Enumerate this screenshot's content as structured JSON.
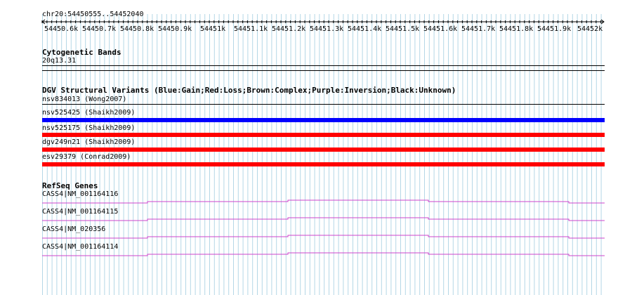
{
  "track": {
    "coordinate_label": "chr20:54450555..54452040",
    "ruler_ticks": [
      "54450.6k",
      "54450.7k",
      "54450.8k",
      "54450.9k",
      "54451k",
      "54451.1k",
      "54451.2k",
      "54451.3k",
      "54451.4k",
      "54451.5k",
      "54451.6k",
      "54451.7k",
      "54451.8k",
      "54451.9k",
      "54452k"
    ]
  },
  "cytogenetic": {
    "title": "Cytogenetic Bands",
    "band": "20q13.31"
  },
  "dgv": {
    "title": "DGV Structural Variants (Blue:Gain;Red:Loss;Brown:Complex;Purple:Inversion;Black:Unknown)",
    "variants": [
      {
        "label": "nsv834013 (Wong2007)",
        "type": "unknown",
        "color": "#000000"
      },
      {
        "label": "nsv525425 (Shaikh2009)",
        "type": "gain",
        "color": "#0000ff"
      },
      {
        "label": "nsv525175 (Shaikh2009)",
        "type": "loss",
        "color": "#ff0000"
      },
      {
        "label": "dgv249n21 (Shaikh2009)",
        "type": "loss",
        "color": "#ff0000"
      },
      {
        "label": "esv29379 (Conrad2009)",
        "type": "loss",
        "color": "#ff0000"
      }
    ]
  },
  "refseq": {
    "title": "RefSeq Genes",
    "genes": [
      {
        "label": "CASS4|NM_001164116"
      },
      {
        "label": "CASS4|NM_001164115"
      },
      {
        "label": "CASS4|NM_020356"
      },
      {
        "label": "CASS4|NM_001164114"
      }
    ],
    "color": "#cc44cc"
  },
  "colors": {
    "gridline": "#b4d7e6",
    "gain": "#0000ff",
    "loss": "#ff0000",
    "gene": "#cc44cc"
  }
}
